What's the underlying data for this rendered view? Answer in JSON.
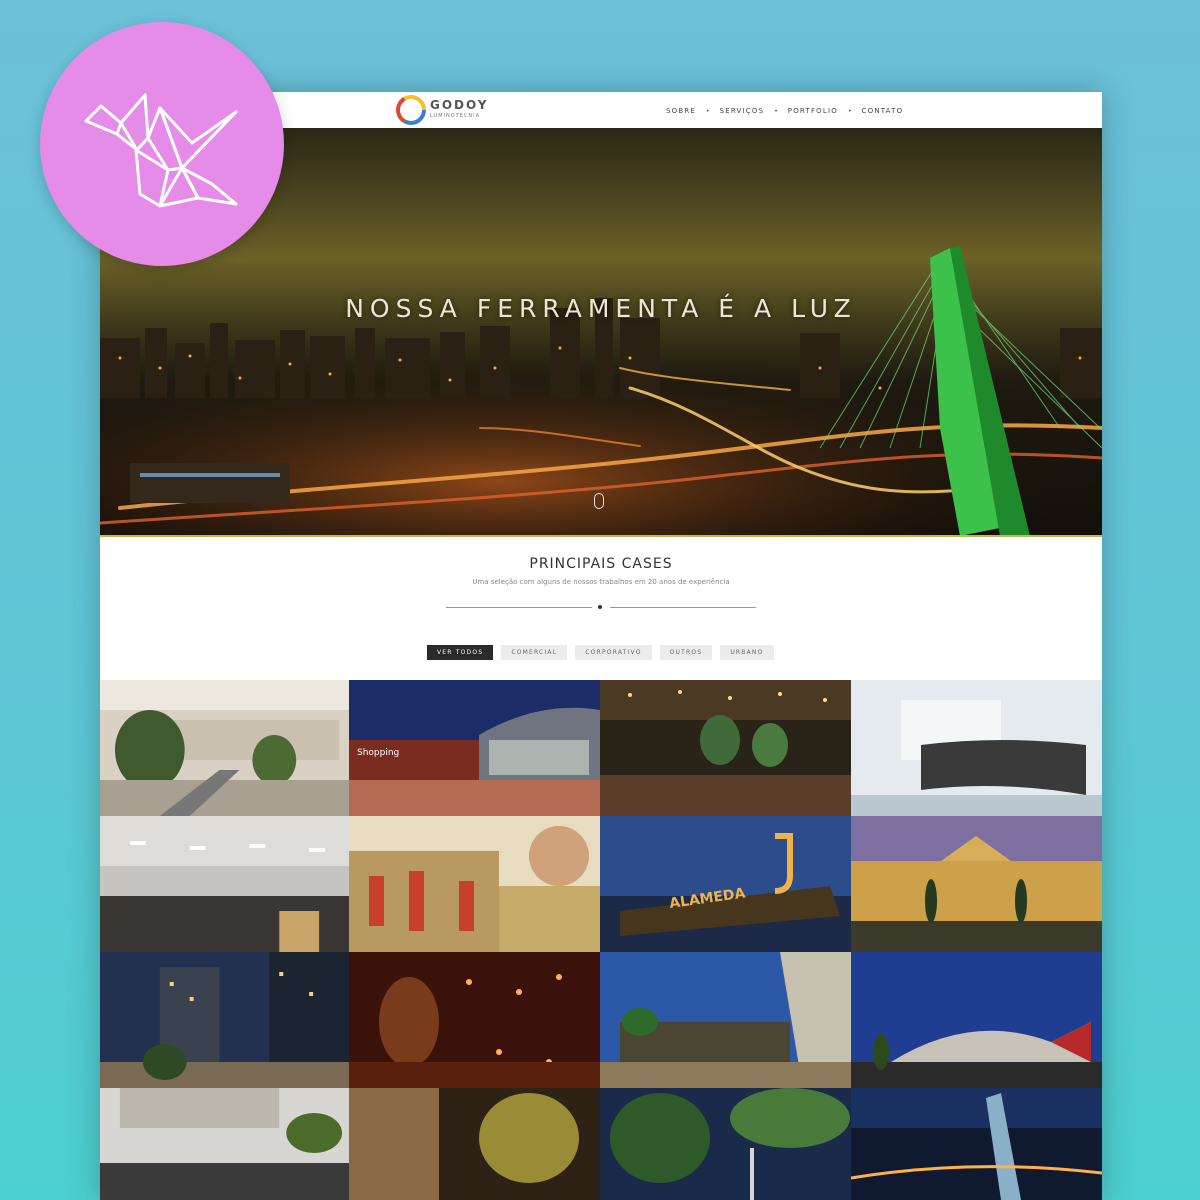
{
  "brand": {
    "name": "GODOY",
    "tagline": "LUMINOTECNIA",
    "logo_icon": "triangle-logo-icon",
    "colors": {
      "red": "#e0453a",
      "yellow": "#f2c12e",
      "blue": "#3a7fd0"
    }
  },
  "nav": {
    "items": [
      {
        "label": "SOBRE"
      },
      {
        "label": "SERVIÇOS"
      },
      {
        "label": "PORTFOLIO"
      },
      {
        "label": "CONTATO"
      }
    ],
    "separator": "•"
  },
  "hero": {
    "title": "NOSSA FERRAMENTA É A LUZ",
    "scroll_icon": "mouse-scroll-icon"
  },
  "cases": {
    "title": "PRINCIPAIS CASES",
    "subtitle": "Uma seleção com alguns de nossos trabalhos em 20 anos de experiência",
    "filters": [
      {
        "label": "VER TODOS",
        "active": true
      },
      {
        "label": "COMERCIAL",
        "active": false
      },
      {
        "label": "CORPORATIVO",
        "active": false
      },
      {
        "label": "OUTROS",
        "active": false
      },
      {
        "label": "URBANO",
        "active": false
      }
    ],
    "tiles": [
      {
        "text": ""
      },
      {
        "text": "Shopping"
      },
      {
        "text": ""
      },
      {
        "text": ""
      },
      {
        "text": ""
      },
      {
        "text": ""
      },
      {
        "text": "ALAMEDA"
      },
      {
        "text": ""
      },
      {
        "text": ""
      },
      {
        "text": ""
      },
      {
        "text": ""
      },
      {
        "text": ""
      },
      {
        "text": ""
      },
      {
        "text": ""
      },
      {
        "text": ""
      },
      {
        "text": ""
      }
    ]
  },
  "badge": {
    "icon": "paper-crane-icon",
    "color": "#e58be8"
  }
}
